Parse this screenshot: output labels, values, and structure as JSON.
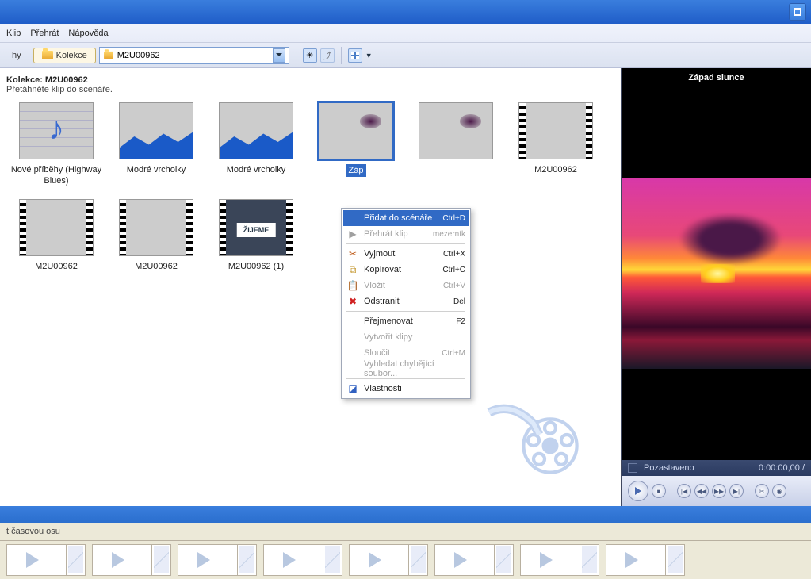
{
  "menu": {
    "klip": "Klip",
    "prehrat": "Přehrát",
    "napoveda": "Nápověda"
  },
  "toolbar": {
    "hy": "hy",
    "kolekce": "Kolekce",
    "dropdown": "M2U00962"
  },
  "header": {
    "title_prefix": "Kolekce: ",
    "title_name": "M2U00962",
    "subtitle": "Přetáhněte klip do scénáře."
  },
  "thumbs": [
    {
      "id": "t1",
      "type": "music",
      "label": "Nové příběhy (Highway Blues)"
    },
    {
      "id": "t2",
      "type": "mtn",
      "label": "Modré vrcholky"
    },
    {
      "id": "t3",
      "type": "mtn",
      "label": "Modré vrcholky"
    },
    {
      "id": "t4",
      "type": "sunset",
      "label": "Záp",
      "selected": true
    },
    {
      "id": "t5",
      "type": "sunset",
      "label": ""
    },
    {
      "id": "t6",
      "type": "video1",
      "label": "M2U00962"
    },
    {
      "id": "t7",
      "type": "video1",
      "label": "M2U00962"
    },
    {
      "id": "t8",
      "type": "video1",
      "label": "M2U00962"
    },
    {
      "id": "t9",
      "type": "video2",
      "label": "M2U00962 (1)"
    }
  ],
  "ctx": {
    "pridat": {
      "label": "Přidat do scénáře",
      "shortcut": "Ctrl+D"
    },
    "prehrat": {
      "label": "Přehrát klip",
      "shortcut": "mezerník"
    },
    "vyjmout": {
      "label": "Vyjmout",
      "shortcut": "Ctrl+X"
    },
    "kopirovat": {
      "label": "Kopírovat",
      "shortcut": "Ctrl+C"
    },
    "vlozit": {
      "label": "Vložit",
      "shortcut": "Ctrl+V"
    },
    "odstranit": {
      "label": "Odstranit",
      "shortcut": "Del"
    },
    "prejmen": {
      "label": "Přejmenovat",
      "shortcut": "F2"
    },
    "vytvorit": {
      "label": "Vytvořit klipy",
      "shortcut": ""
    },
    "sloucit": {
      "label": "Sloučit",
      "shortcut": "Ctrl+M"
    },
    "vyhledat": {
      "label": "Vyhledat chybějící soubor...",
      "shortcut": ""
    },
    "vlast": {
      "label": "Vlastnosti",
      "shortcut": ""
    }
  },
  "preview": {
    "title": "Západ slunce",
    "status": "Pozastaveno",
    "time": "0:00:00,00 /"
  },
  "timeline": {
    "label": "t časovou osu"
  }
}
